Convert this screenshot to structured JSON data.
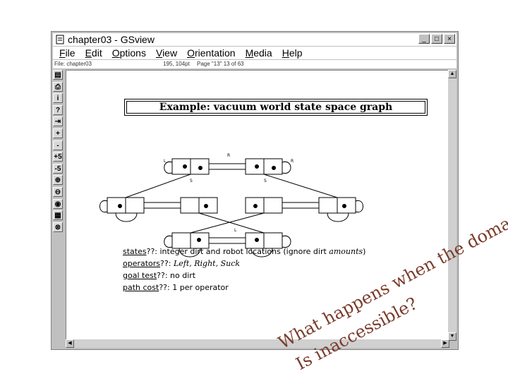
{
  "window": {
    "title": "chapter03 - GSview",
    "controls": [
      "_",
      "□",
      "×"
    ]
  },
  "menu": [
    {
      "label": "File",
      "u": "F"
    },
    {
      "label": "Edit",
      "u": "E"
    },
    {
      "label": "Options",
      "u": "O"
    },
    {
      "label": "View",
      "u": "V"
    },
    {
      "label": "Orientation",
      "u": "O"
    },
    {
      "label": "Media",
      "u": "M"
    },
    {
      "label": "Help",
      "u": "H"
    }
  ],
  "status": {
    "file": "File: chapter03",
    "coords": "195, 104pt",
    "page": "Page \"13\"  13 of 63"
  },
  "toolbar": [
    "open-icon",
    "print-icon",
    "info-icon",
    "help-icon",
    "goto-icon",
    "plus-icon",
    "minus-icon",
    "plus5-icon",
    "minus5-icon",
    "zoom-in-icon",
    "zoom-out-icon",
    "magnify-icon",
    "ruler-icon",
    "orient-icon"
  ],
  "toolbar_labels": [
    "▤",
    "⎙",
    "i",
    "?",
    "⇥",
    "+",
    "-",
    "+5",
    "-5",
    "⊕",
    "⊖",
    "◉",
    "▦",
    "⊗"
  ],
  "slide": {
    "title": "Example: vacuum world state space graph",
    "labels": {
      "R": "R",
      "L": "L",
      "S": "S"
    },
    "defs": [
      {
        "term": "states",
        "q": "??",
        "text": ": integer dirt and robot locations (ignore dirt ",
        "italic": "amounts",
        "end": ")"
      },
      {
        "term": "operators",
        "q": "??",
        "text": ": ",
        "italic": "Left, Right, Suck",
        "end": ""
      },
      {
        "term": "goal test",
        "q": "??",
        "text": ": no dirt",
        "italic": "",
        "end": ""
      },
      {
        "term": "path cost",
        "q": "??",
        "text": ": 1 per operator",
        "italic": "",
        "end": ""
      }
    ]
  },
  "watermark": {
    "line1": "What happens when the domain",
    "line2": "Is inaccessible?"
  },
  "colors": {
    "watermark": "#7a3b2b",
    "chrome": "#c0c0c0"
  }
}
